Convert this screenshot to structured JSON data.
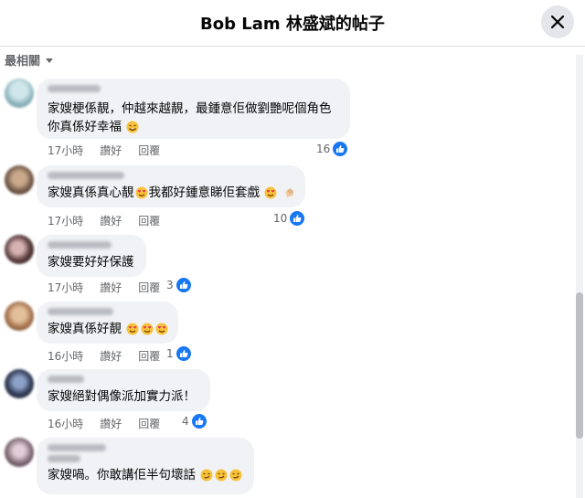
{
  "header": {
    "title": "Bob Lam 林盛斌的帖子"
  },
  "sort": {
    "label": "最相關"
  },
  "actions": {
    "like": "讚好",
    "reply": "回覆"
  },
  "comments": [
    {
      "text_lines": [
        "家嫂梗係靚，仲越來越靚，最鍾意佢做劉艷呢個角色",
        "你真係好幸福"
      ],
      "time": "17小時",
      "reactions": "16",
      "trailing_emoji": "rofl-emoji"
    },
    {
      "text_lines": [
        "家嫂真係真心靚",
        "我都好鍾意睇佢套戲"
      ],
      "time": "17小時",
      "reactions": "10",
      "trailing_emoji": "heart-eyes-emoji clap-emoji"
    },
    {
      "text_lines": [
        "家嫂要好好保護"
      ],
      "time": "17小時",
      "reactions": "3"
    },
    {
      "text_lines": [
        "家嫂真係好靚"
      ],
      "time": "16小時",
      "reactions": "1",
      "trailing_emoji": "heart-eyes-emoji x3"
    },
    {
      "text_lines": [
        "家嫂絕對偶像派加實力派！"
      ],
      "time": "16小時",
      "reactions": "4"
    },
    {
      "text_lines": [
        "家嫂喎。你敢講佢半句壞話"
      ],
      "trailing_emoji": "smirk-emoji x3"
    }
  ],
  "colors": {
    "accent": "#1877f2",
    "bubble": "#f0f2f5",
    "meta": "#65676b"
  }
}
